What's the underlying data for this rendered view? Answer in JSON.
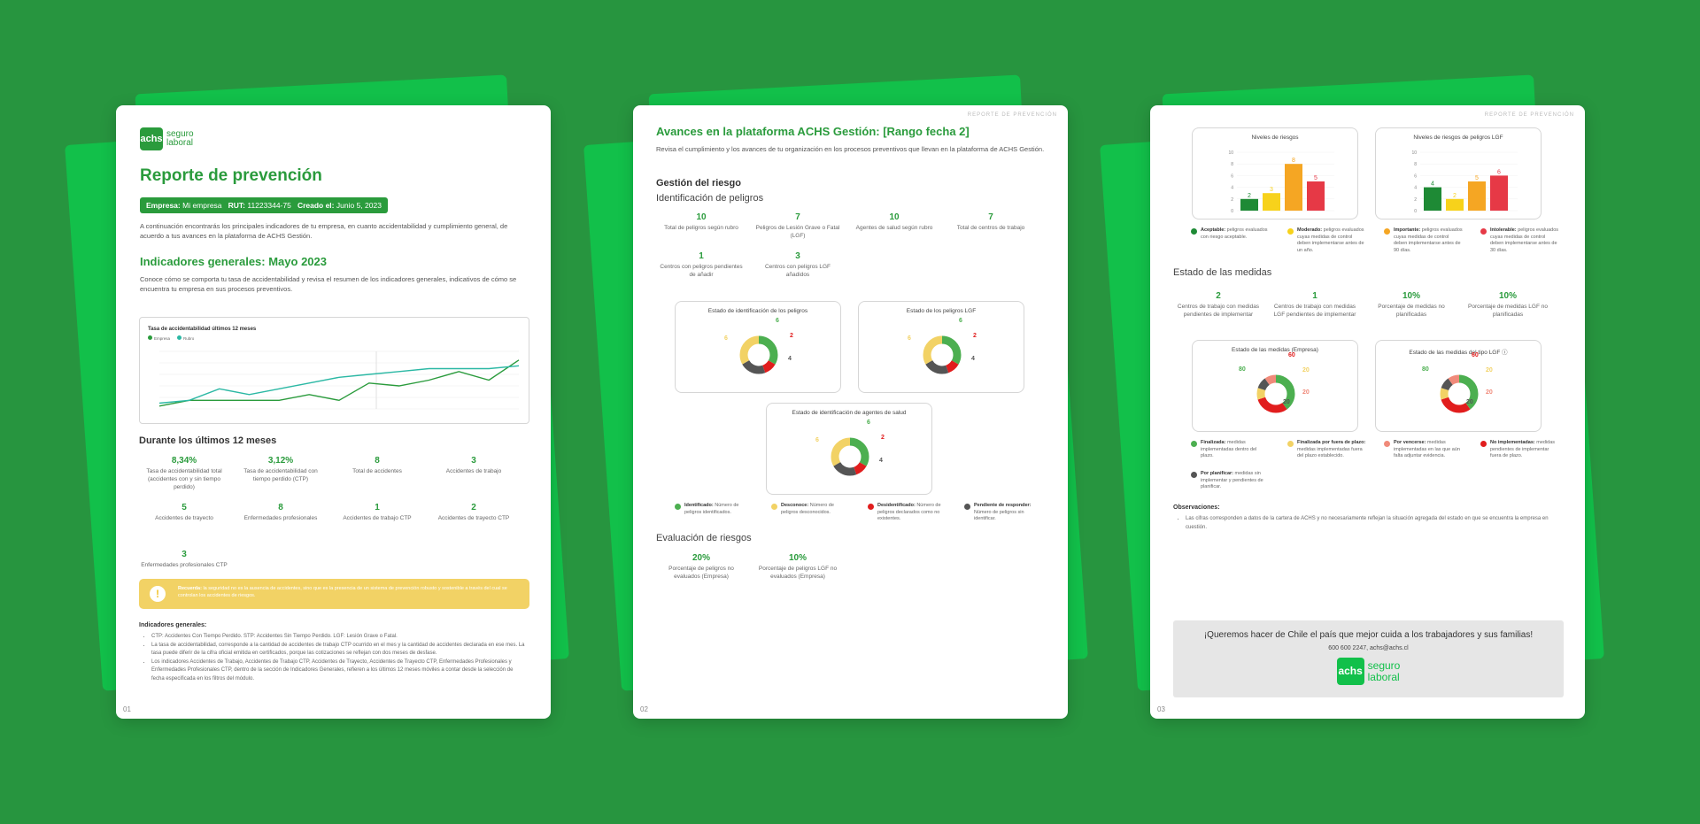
{
  "brand": {
    "logo_mark": "achs",
    "logo_line1": "seguro",
    "logo_line2": "laboral"
  },
  "colors": {
    "background": "#27953f",
    "slab": "#12c04a",
    "accent": "#2a9b3c",
    "yellow": "#f2d265",
    "red": "#e11d1d",
    "gray": "#555555"
  },
  "page1": {
    "number": "01",
    "title": "Reporte de prevención",
    "meta": {
      "empresa_label": "Empresa:",
      "empresa": "Mi empresa",
      "rut_label": "RUT:",
      "rut": "11223344-75",
      "creado_label": "Creado el:",
      "creado": "Junio 5, 2023"
    },
    "intro": "A continuación encontrarás los principales indicadores de tu empresa, en cuanto accidentabilidad y cumplimiento general, de acuerdo a tus avances en la plataforma de ACHS Gestión.",
    "section_title": "Indicadores generales: Mayo 2023",
    "section_text": "Conoce cómo se comporta tu tasa de accidentabilidad y revisa el resumen de los indicadores generales, indicativos de cómo se encuentra tu empresa en sus procesos preventivos.",
    "chart_card": {
      "chart_data": {
        "type": "line",
        "title": "Tasa de accidentabilidad últimos 12 meses",
        "series": [
          {
            "name": "Empresa",
            "color": "#2a9b3c",
            "values": [
              1,
              3,
              3,
              3,
              3,
              5,
              3,
              9,
              8,
              10,
              13,
              10,
              17
            ]
          },
          {
            "name": "Rubro",
            "color": "#2bb8a4",
            "values": [
              2,
              3,
              7,
              5,
              7,
              9,
              11,
              12,
              13,
              14,
              14,
              14,
              15
            ]
          }
        ]
      }
    },
    "twelve_title": "Durante los últimos 12 meses",
    "stats": [
      {
        "value": "8,34%",
        "label": "Tasa de accidentabilidad total (accidentes con y sin tiempo perdido)"
      },
      {
        "value": "3,12%",
        "label": "Tasa de accidentabilidad con tiempo perdido (CTP)"
      },
      {
        "value": "8",
        "label": "Total de accidentes"
      },
      {
        "value": "3",
        "label": "Accidentes de trabajo"
      },
      {
        "value": "5",
        "label": "Accidentes de trayecto"
      },
      {
        "value": "8",
        "label": "Enfermedades profesionales"
      },
      {
        "value": "1",
        "label": "Accidentes de trabajo CTP"
      },
      {
        "value": "2",
        "label": "Accidentes de trayecto CTP"
      },
      {
        "value": "3",
        "label": "Enfermedades profesionales CTP"
      }
    ],
    "notice": {
      "bold": "Recuerda:",
      "text": "la seguridad no es la ausencia de accidentes, sino que es la presencia de un sistema de prevención robusto y sostenible a través del cual se controlan los accidentes de riesgos."
    },
    "notes_title": "Indicadores generales:",
    "notes": [
      "CTP: Accidentes Con Tiempo Perdido. STP: Accidentes Sin Tiempo Perdido. LGF: Lesión Grave o Fatal.",
      "La tasa de accidentabilidad, corresponde a la cantidad de accidentes de trabajo CTP ocurrido en el mes y la cantidad de accidentes declarada en ese mes. La tasa puede diferir de la cifra oficial emitida en certificados, porque las cotizaciones se reflejan con dos meses de desfase.",
      "Los indicadores Accidentes de Trabajo, Accidentes de Trabajo CTP, Accidentes de Trayecto, Accidentes de Trayecto CTP, Enfermedades Profesionales y Enfermedades Profesionales CTP, dentro de la sección de Indicadores Generales, refieren a los últimos 12 meses móviles a contar desde la selección de fecha especificada en los filtros del módulo."
    ]
  },
  "page2": {
    "number": "02",
    "running_head": "Reporte de prevención",
    "title": "Avances en la plataforma ACHS Gestión: [Rango fecha 2]",
    "intro": "Revisa el cumplimiento y los avances de tu organización en los procesos preventivos que llevan en la plataforma de ACHS Gestión.",
    "risk_title": "Gestión del riesgo",
    "ident_title": "Identificación de peligros",
    "stats": [
      {
        "value": "10",
        "label": "Total de peligros según rubro"
      },
      {
        "value": "7",
        "label": "Peligros de Lesión Grave o Fatal (LGF)"
      },
      {
        "value": "10",
        "label": "Agentes de salud según rubro"
      },
      {
        "value": "7",
        "label": "Total de centros de trabajo"
      },
      {
        "value": "1",
        "label": "Centros con peligros pendientes de añadir"
      },
      {
        "value": "3",
        "label": "Centros con peligros LGF añadidos"
      }
    ],
    "donuts": [
      {
        "title": "Estado de identificación de los peligros",
        "chart_data": {
          "type": "pie",
          "values": [
            6,
            2,
            4,
            6
          ],
          "labels": [
            "Identificado",
            "Desidentificado",
            "Pendiente de responder",
            "Desconoce"
          ]
        }
      },
      {
        "title": "Estado de los peligros LGF",
        "chart_data": {
          "type": "pie",
          "values": [
            6,
            2,
            4,
            6
          ],
          "labels": [
            "Identificado",
            "Desidentificado",
            "Pendiente de responder",
            "Desconoce"
          ]
        }
      },
      {
        "title": "Estado de identificación de agentes de salud",
        "chart_data": {
          "type": "pie",
          "values": [
            6,
            2,
            4,
            6
          ],
          "labels": [
            "Identificado",
            "Desidentificado",
            "Pendiente de responder",
            "Desconoce"
          ]
        }
      }
    ],
    "legend": [
      {
        "bold": "Identificado:",
        "text": "Número de peligros identificados.",
        "color": "#4caf50"
      },
      {
        "bold": "Desconoce:",
        "text": "Número de peligros desconocidos.",
        "color": "#f2d265"
      },
      {
        "bold": "Desidentificado:",
        "text": "Número de peligros declarados como no existentes.",
        "color": "#e11d1d"
      },
      {
        "bold": "Pendiente de responder:",
        "text": "Número de peligros sin identificar.",
        "color": "#555555"
      }
    ],
    "eval_title": "Evaluación de riesgos",
    "eval_stats": [
      {
        "value": "20%",
        "label": "Porcentaje de peligros no evaluados (Empresa)"
      },
      {
        "value": "10%",
        "label": "Porcentaje de peligros LGF no evaluados (Empresa)"
      }
    ]
  },
  "page3": {
    "number": "03",
    "running_head": "Reporte de prevención",
    "bars": [
      {
        "title": "Niveles de riesgos",
        "chart_data": {
          "type": "bar",
          "categories": [
            "Aceptable",
            "Moderado",
            "Importante",
            "Intolerable"
          ],
          "values": [
            2,
            3,
            8,
            5
          ],
          "ylim": [
            0,
            10
          ],
          "ticks": [
            "10",
            "8",
            "6",
            "4",
            "2",
            "0"
          ],
          "colors": [
            "#1e8a35",
            "#f7d21b",
            "#f5a623",
            "#e63946"
          ]
        }
      },
      {
        "title": "Niveles de riesgos de peligros LGF",
        "chart_data": {
          "type": "bar",
          "categories": [
            "Aceptable",
            "Moderado",
            "Importante",
            "Intolerable"
          ],
          "values": [
            4,
            2,
            5,
            6
          ],
          "ylim": [
            0,
            10
          ],
          "ticks": [
            "10",
            "8",
            "6",
            "4",
            "2",
            "0"
          ],
          "colors": [
            "#1e8a35",
            "#f7d21b",
            "#f5a623",
            "#e63946"
          ]
        }
      }
    ],
    "bar_legend": [
      {
        "bold": "Aceptable:",
        "text": "peligros evaluados con riesgo aceptable.",
        "color": "#1e8a35"
      },
      {
        "bold": "Moderado:",
        "text": "peligros evaluados cuyas medidas de control deben implementarse antes de un año.",
        "color": "#f7d21b"
      },
      {
        "bold": "Importante:",
        "text": "peligros evaluados cuyas medidas de control deben implementarse antes de 90 días.",
        "color": "#f5a623"
      },
      {
        "bold": "Intolerable:",
        "text": "peligros evaluados cuyas medidas de control deben implementarse antes de 30 días.",
        "color": "#e63946"
      }
    ],
    "measures_title": "Estado de las medidas",
    "stats": [
      {
        "value": "2",
        "label": "Centros de trabajo con medidas pendientes de implementar"
      },
      {
        "value": "1",
        "label": "Centros de trabajo con medidas LGF pendientes de implementar"
      },
      {
        "value": "10%",
        "label": "Porcentaje de medidas no planificadas"
      },
      {
        "value": "10%",
        "label": "Porcentaje de medidas LGF no planificadas"
      }
    ],
    "donuts": [
      {
        "title": "Estado de las medidas (Empresa)",
        "chart_data": {
          "type": "pie",
          "values": [
            80,
            60,
            20,
            20,
            20
          ],
          "labels": [
            "Finalizada",
            "No implementadas",
            "Finalizada por fuera de plazo",
            "Por planificar",
            "Por vencer"
          ]
        }
      },
      {
        "title": "Estado de las medidas del tipo LGF ⓘ",
        "chart_data": {
          "type": "pie",
          "values": [
            80,
            60,
            20,
            20,
            20
          ],
          "labels": [
            "Finalizada",
            "No implementadas",
            "Finalizada por fuera de plazo",
            "Por planificar",
            "Por vencer"
          ]
        }
      }
    ],
    "legend": [
      {
        "bold": "Finalizada:",
        "text": "medidas implementadas dentro del plazo.",
        "color": "#4caf50"
      },
      {
        "bold": "Finalizada por fuera de plazo:",
        "text": "medidas implementadas fuera del plazo establecido.",
        "color": "#f2d265"
      },
      {
        "bold": "Por vencerse:",
        "text": "medidas implementadas en las que aún falta adjuntar evidencia.",
        "color": "#f08a7a"
      },
      {
        "bold": "No implementadas:",
        "text": "medidas pendientes de implementar fuera de plazo.",
        "color": "#e11d1d"
      },
      {
        "bold": "Por planificar:",
        "text": "medidas sin implementar y pendientes de planificar.",
        "color": "#555555"
      }
    ],
    "obs_title": "Observaciones:",
    "obs": "Las cifras corresponden a datos de la cartera de ACHS y no necesariamente reflejan la situación agregada del estado en que se encuentra la empresa en cuestión.",
    "footer_title": "¡Queremos hacer de Chile el país que mejor cuida a los trabajadores y sus familias!",
    "footer_contact": "600 600 2247, achs@achs.cl"
  }
}
